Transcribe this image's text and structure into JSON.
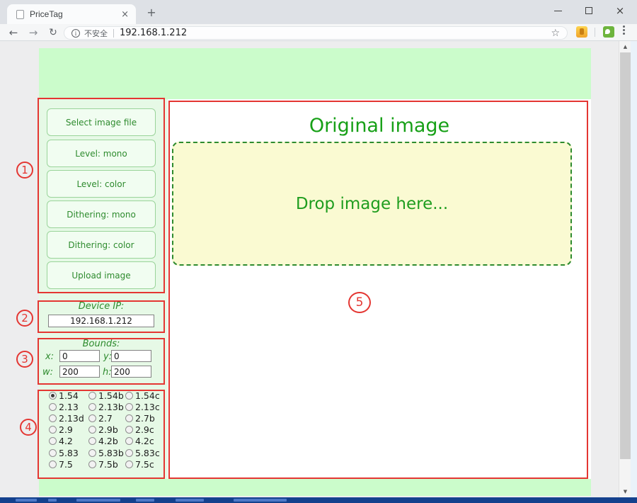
{
  "browser": {
    "tab_title": "PriceTag",
    "security_label": "不安全",
    "url": "192.168.1.212"
  },
  "icons": {
    "back": "←",
    "forward": "→",
    "refresh": "↻",
    "info": "i",
    "star": "☆",
    "tab_close": "×",
    "new_tab": "+",
    "window_close": "×",
    "scroll_up": "▲",
    "scroll_down": "▼"
  },
  "page": {
    "sidebar": {
      "buttons": [
        "Select image file",
        "Level: mono",
        "Level: color",
        "Dithering: mono",
        "Dithering: color",
        "Upload image"
      ],
      "device_ip": {
        "label": "Device IP:",
        "value": "192.168.1.212"
      },
      "bounds": {
        "label": "Bounds:",
        "fields": [
          {
            "label": "x:",
            "value": "0"
          },
          {
            "label": "y:",
            "value": "0"
          },
          {
            "label": "w:",
            "value": "200"
          },
          {
            "label": "h:",
            "value": "200"
          }
        ]
      },
      "display_sizes": {
        "options": [
          "1.54",
          "1.54b",
          "1.54c",
          "2.13",
          "2.13b",
          "2.13c",
          "2.13d",
          "2.7",
          "2.7b",
          "2.9",
          "2.9b",
          "2.9c",
          "4.2",
          "4.2b",
          "4.2c",
          "5.83",
          "5.83b",
          "5.83c",
          "7.5",
          "7.5b",
          "7.5c"
        ],
        "selected": "1.54",
        "columns": 3
      }
    },
    "main": {
      "title": "Original image",
      "dropzone_text": "Drop image here..."
    }
  },
  "annotations": {
    "markers": [
      "1",
      "2",
      "3",
      "4",
      "5"
    ],
    "color": "#e43632"
  },
  "colors": {
    "band_green": "#cbfccb",
    "sidebar_green": "#e6f9e6",
    "button_green": "#f1fdf1",
    "text_green": "#2e8b2e",
    "title_green": "#17a017",
    "dropzone_yellow": "#fafad2",
    "annotation_red": "#e43632"
  }
}
